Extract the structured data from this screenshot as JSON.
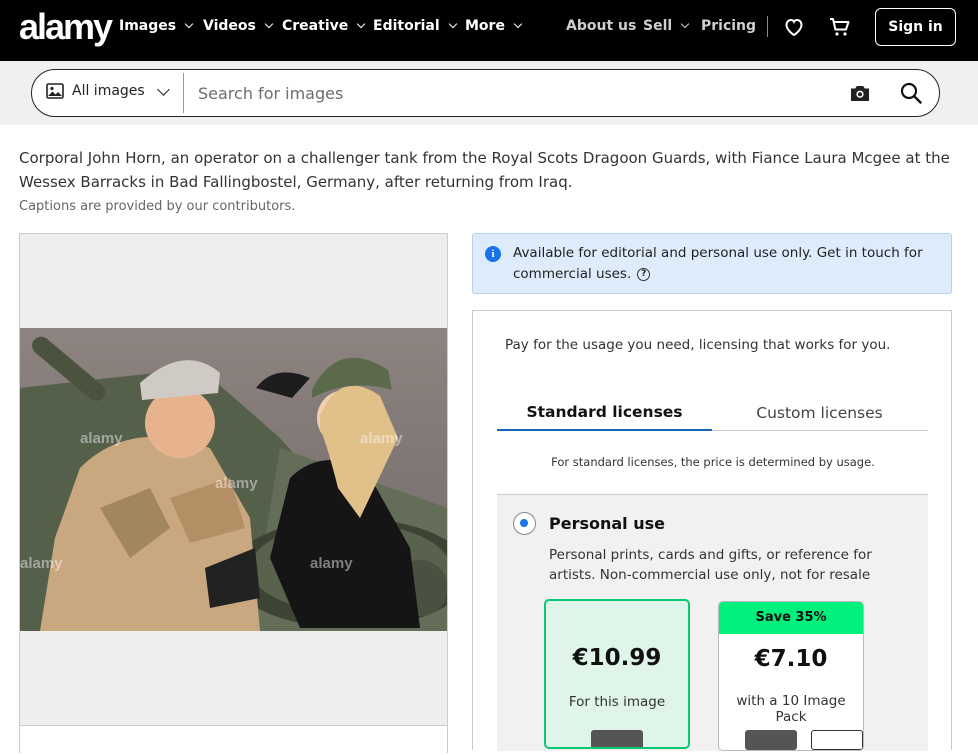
{
  "brand": {
    "logo": "alamy"
  },
  "nav": {
    "items": [
      {
        "label": "Images"
      },
      {
        "label": "Videos"
      },
      {
        "label": "Creative"
      },
      {
        "label": "Editorial"
      },
      {
        "label": "More"
      }
    ],
    "about": "About us",
    "sell": "Sell",
    "pricing": "Pricing",
    "signin": "Sign in"
  },
  "search": {
    "scope": "All images",
    "placeholder": "Search for images"
  },
  "image": {
    "caption": "Corporal John Horn, an operator on a challenger tank from the Royal Scots Dragoon Guards, with Fiance Laura Mcgee at the Wessex Barracks in Bad Fallingbostel, Germany, after returning from Iraq.",
    "caption_note": "Captions are provided by our contributors.",
    "watermark": "alamy"
  },
  "notice": {
    "text": "Available for editorial and personal use only. Get in touch for commercial uses."
  },
  "licensing": {
    "intro": "Pay for the usage you need, licensing that works for you.",
    "tabs": [
      {
        "label": "Standard licenses",
        "active": true
      },
      {
        "label": "Custom licenses",
        "active": false
      }
    ],
    "note": "For standard licenses, the price is determined by usage.",
    "use": {
      "title": "Personal use",
      "description": "Personal prints, cards and gifts, or reference for artists. Non-commercial use only, not for resale"
    },
    "prices": [
      {
        "amount": "€10.99",
        "label": "For this image",
        "selected": true
      },
      {
        "amount": "€7.10",
        "label": "with a 10 Image Pack",
        "banner": "Save 35%",
        "selected": false
      }
    ]
  },
  "colors": {
    "nav_bg": "#000000",
    "accent_blue": "#1967b2",
    "save_green": "#00f07c",
    "selected_border": "#0ac774",
    "notice_bg": "#ddebfb"
  }
}
